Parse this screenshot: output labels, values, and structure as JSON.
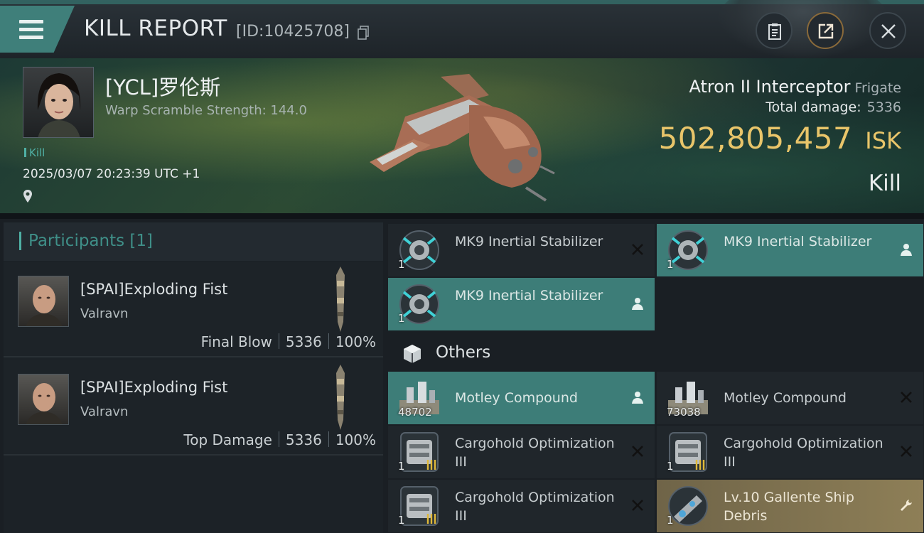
{
  "header": {
    "title": "KILL REPORT",
    "report_id": "[ID:10425708]",
    "icons": [
      "menu-icon",
      "copy-icon",
      "clipboard-icon",
      "share-icon",
      "close-icon"
    ]
  },
  "victim": {
    "name": "[YCL]罗伦斯",
    "warp_scramble": "Warp Scramble Strength: 144.0",
    "tag": "Kill",
    "datetime": "2025/03/07 20:23:39 UTC +1",
    "ship_name": "Atron II Interceptor",
    "ship_class": "Frigate",
    "total_damage_label": "Total damage:",
    "total_damage": "5336",
    "isk_value": "502,805,457",
    "isk_unit": "ISK",
    "result": "Kill"
  },
  "participants": {
    "title": "Participants [1]",
    "rows": [
      {
        "name": "[SPAI]Exploding Fist",
        "ship": "Valravn",
        "role": "Final Blow",
        "damage": "5336",
        "percent": "100%"
      },
      {
        "name": "[SPAI]Exploding Fist",
        "ship": "Valravn",
        "role": "Top Damage",
        "damage": "5336",
        "percent": "100%"
      }
    ]
  },
  "items": {
    "modules": [
      {
        "name": "MK9 Inertial Stabilizer",
        "qty": "1",
        "state": "destroyed",
        "action_icon": "close-icon"
      },
      {
        "name": "MK9 Inertial Stabilizer",
        "qty": "1",
        "state": "dropped",
        "action_icon": "person-icon"
      },
      {
        "name": "MK9 Inertial Stabilizer",
        "qty": "1",
        "state": "dropped",
        "action_icon": "person-icon"
      }
    ],
    "others_title": "Others",
    "others": [
      {
        "name": "Motley Compound",
        "qty": "48702",
        "state": "dropped",
        "action_icon": "person-icon"
      },
      {
        "name": "Motley Compound",
        "qty": "73038",
        "state": "destroyed",
        "action_icon": "close-icon"
      },
      {
        "name": "Cargohold Optimization III",
        "qty": "1",
        "state": "destroyed",
        "action_icon": "close-icon"
      },
      {
        "name": "Cargohold Optimization III",
        "qty": "1",
        "state": "destroyed",
        "action_icon": "close-icon"
      },
      {
        "name": "Cargohold Optimization III",
        "qty": "1",
        "state": "destroyed",
        "action_icon": "close-icon"
      },
      {
        "name": "Lv.10 Gallente Ship Debris",
        "qty": "1",
        "state": "special",
        "action_icon": "wrench-icon"
      }
    ]
  },
  "colors": {
    "accent_teal": "#3d7d78",
    "isk_gold": "#e9c56a",
    "special_gold": "#8e7f57"
  }
}
